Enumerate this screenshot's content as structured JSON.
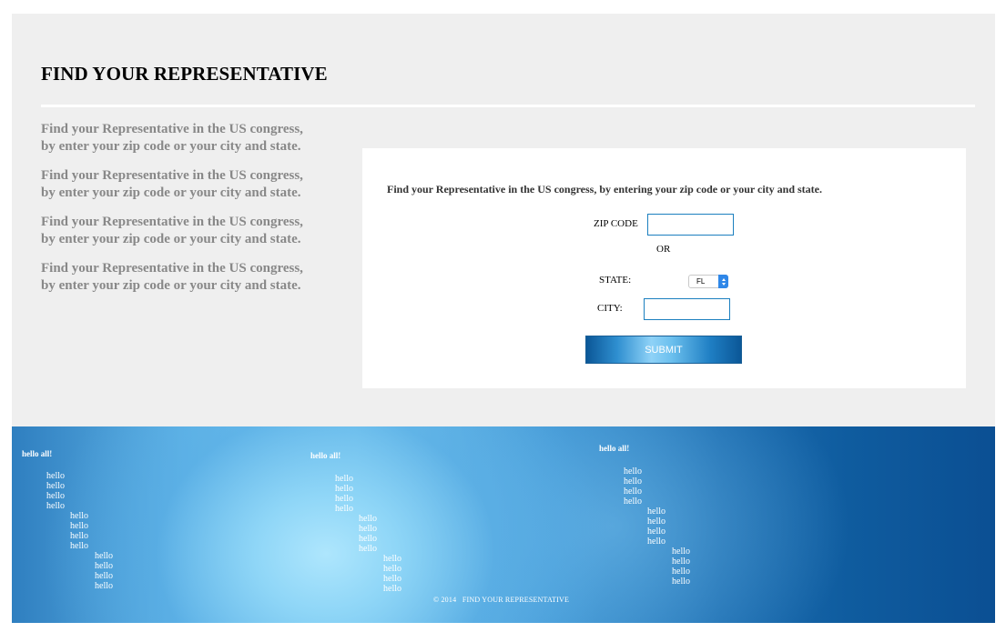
{
  "header": {
    "title": "FIND YOUR REPRESENTATIVE"
  },
  "blurbs": [
    {
      "line1": "Find your Representative in the US congress,",
      "line2": "by enter your zip code or your city and state."
    },
    {
      "line1": "Find your Representative in the US congress,",
      "line2": "by enter your zip code or your city and state."
    },
    {
      "line1": "Find your Representative in the US congress,",
      "line2": "by enter your zip code or your city and state."
    },
    {
      "line1": "Find your Representative in the US congress,",
      "line2": "by enter your zip code or your city and state."
    }
  ],
  "form": {
    "intro": "Find your Representative in the US congress, by entering your zip code or your city and state.",
    "zip_label": "ZIP CODE",
    "zip_value": "",
    "or_label": "OR",
    "state_label": "STATE:",
    "state_value": "FL",
    "city_label": "CITY:",
    "city_value": "",
    "submit_label": "SUBMIT"
  },
  "footer": {
    "columns": [
      {
        "greeting": "hello all!",
        "items": [
          "hello",
          "hello",
          "hello",
          "hello",
          "hello",
          "hello",
          "hello",
          "hello",
          "hello",
          "hello",
          "hello",
          "hello"
        ]
      },
      {
        "greeting": "hello all!",
        "items": [
          "hello",
          "hello",
          "hello",
          "hello",
          "hello",
          "hello",
          "hello",
          "hello",
          "hello",
          "hello",
          "hello",
          "hello"
        ]
      },
      {
        "greeting": "hello all!",
        "items": [
          "hello",
          "hello",
          "hello",
          "hello",
          "hello",
          "hello",
          "hello",
          "hello",
          "hello",
          "hello",
          "hello",
          "hello"
        ]
      }
    ],
    "copyright_year": "© 2014",
    "copyright_name": "FIND YOUR REPRESENTATIVE"
  },
  "colors": {
    "panel_bg": "#efefef",
    "input_border": "#1b7fbf",
    "footer_dark": "#0b4f93",
    "footer_light": "#aee6fd"
  }
}
